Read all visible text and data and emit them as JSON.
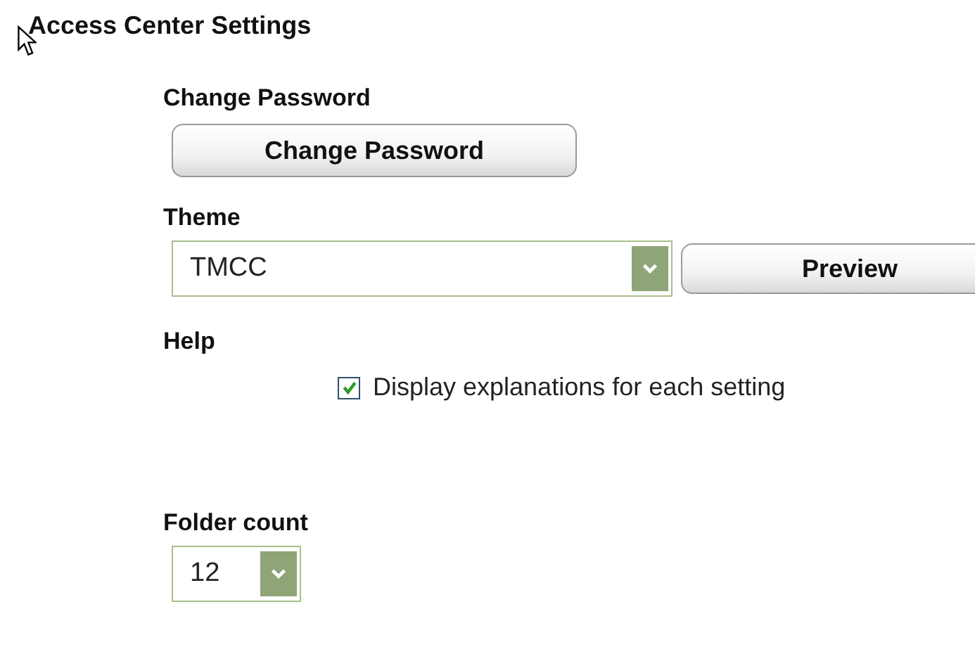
{
  "title": "Access Center Settings",
  "sections": [
    {
      "kind": "button",
      "label": "Change Password",
      "button": "Change Password"
    },
    {
      "kind": "select",
      "label": "Theme",
      "value": "TMCC",
      "button": "Preview"
    },
    {
      "kind": "checkbox",
      "label": "Help",
      "text": "Display explanations for each setting",
      "checked": true
    },
    {
      "kind": "count",
      "label": "Folder count",
      "value": "12"
    }
  ]
}
